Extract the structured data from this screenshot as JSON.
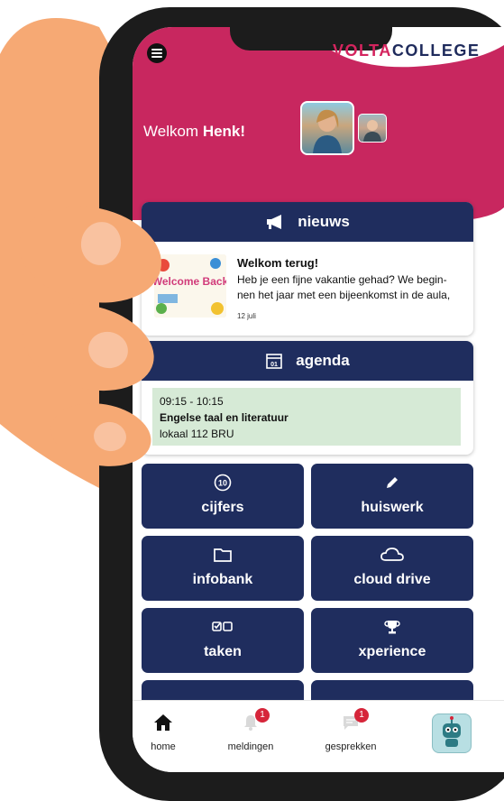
{
  "app": {
    "logo_prefix": "VOLTA",
    "logo_suffix": "COLLEGE"
  },
  "header": {
    "welcome_prefix": "Welkom ",
    "user_name": "Henk!"
  },
  "news": {
    "title": "nieuws",
    "item": {
      "title": "Welkom terug!",
      "text": "Heb je een fijne vakantie gehad? We begin-nen het jaar met een bijeenkomst in de aula,",
      "date": "12 juli",
      "image_text": "Welcome Back"
    }
  },
  "agenda": {
    "title": "agenda",
    "calendar_icon_text": "01",
    "item": {
      "time": "09:15 - 10:15",
      "course": "Engelse taal en literatuur",
      "location": "lokaal 112 BRU"
    }
  },
  "tiles": [
    {
      "label": "cijfers",
      "icon": "grade-10-icon",
      "icon_text": "10"
    },
    {
      "label": "huiswerk",
      "icon": "pencil-icon"
    },
    {
      "label": "infobank",
      "icon": "folder-icon"
    },
    {
      "label": "cloud drive",
      "icon": "cloud-icon"
    },
    {
      "label": "taken",
      "icon": "checklist-icon"
    },
    {
      "label": "xperience",
      "icon": "trophy-icon"
    }
  ],
  "nav": {
    "home": {
      "label": "home",
      "icon": "home-icon"
    },
    "meldingen": {
      "label": "meldingen",
      "badge": "1",
      "icon": "bell-icon"
    },
    "gesprekken": {
      "label": "gesprekken",
      "badge": "1",
      "icon": "chat-icon"
    },
    "robot": {
      "icon": "robot-icon"
    }
  },
  "colors": {
    "header_magenta": "#c8275f",
    "navy": "#1f2d5e",
    "agenda_item_bg": "#d6ead6",
    "skin": "#f6a974",
    "badge_red": "#d6253a"
  }
}
